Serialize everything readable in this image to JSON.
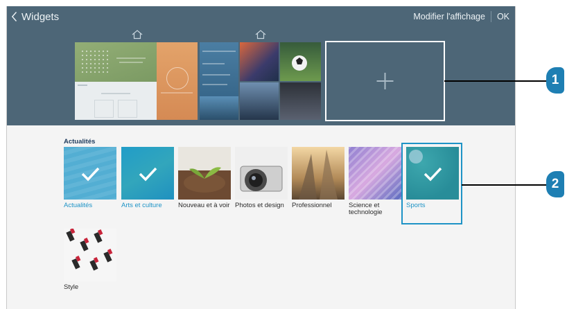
{
  "header": {
    "back_icon": "chevron-left-icon",
    "title": "Widgets",
    "edit_label": "Modifier l'affichage",
    "ok_label": "OK",
    "background": "#4d6677"
  },
  "pages": {
    "home_icon": "home-outline-icon",
    "add_page_icon": "plus-icon"
  },
  "section": {
    "title": "Actualités"
  },
  "categories": [
    {
      "label": "Actualités",
      "selected": true
    },
    {
      "label": "Arts et culture",
      "selected": true
    },
    {
      "label": "Nouveau et à voir",
      "selected": false
    },
    {
      "label": "Photos et design",
      "selected": false
    },
    {
      "label": "Professionnel",
      "selected": false
    },
    {
      "label": "Science et technologie",
      "selected": false
    },
    {
      "label": "Sports",
      "selected": true
    },
    {
      "label": "Style",
      "selected": false
    }
  ],
  "callouts": [
    "1",
    "2"
  ],
  "colors": {
    "accent": "#1e93c6",
    "callout": "#1e7fb3"
  }
}
